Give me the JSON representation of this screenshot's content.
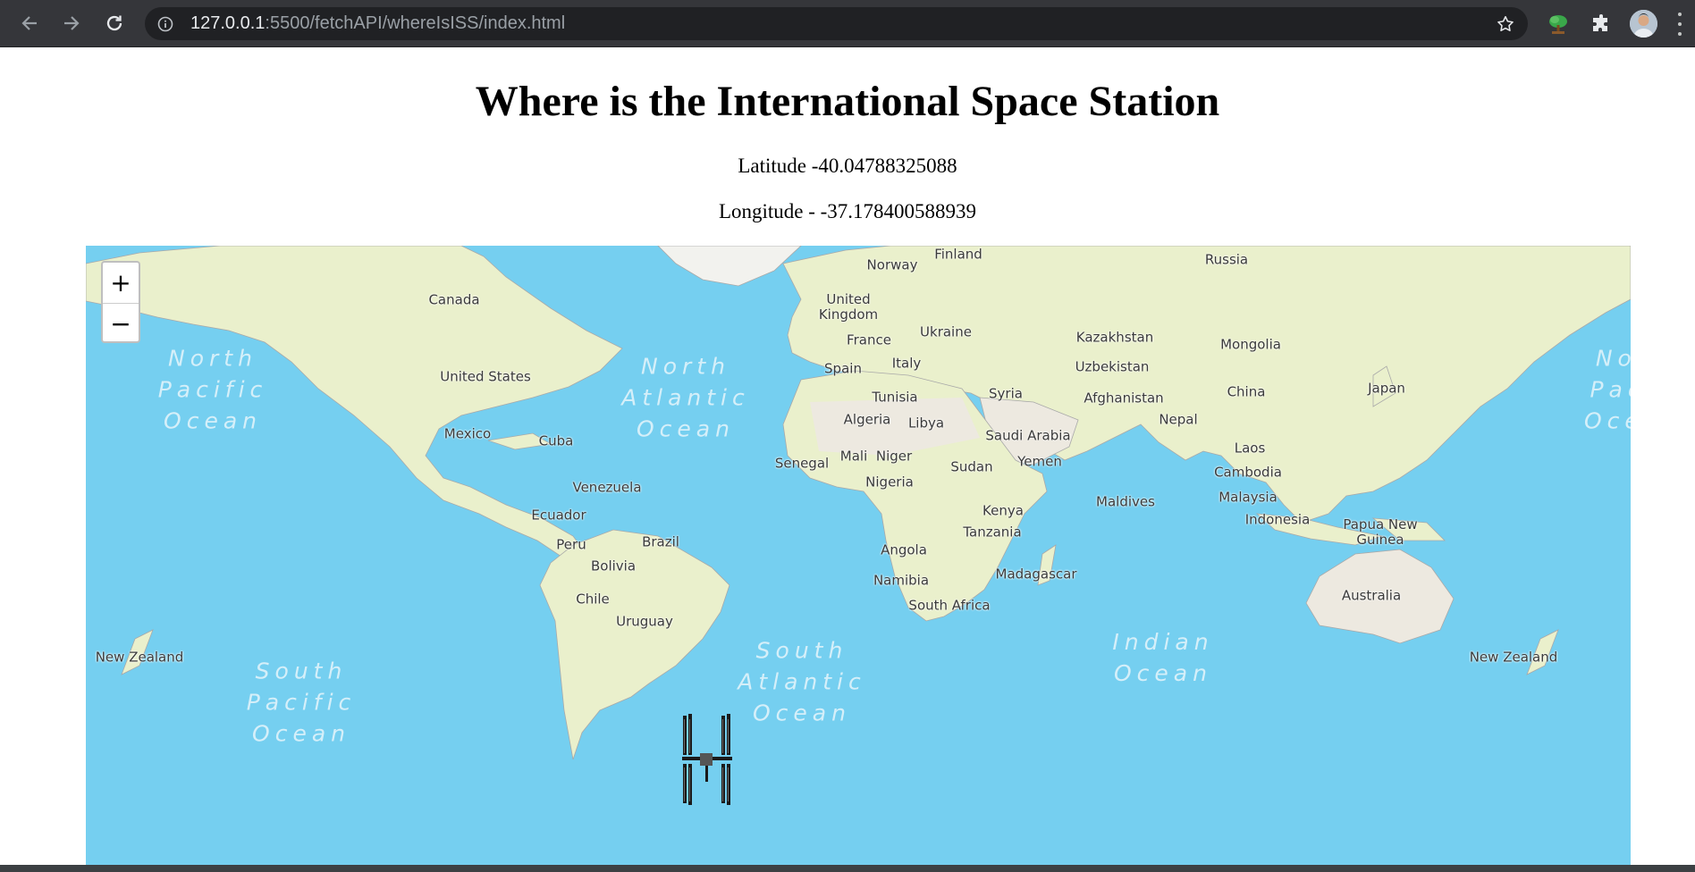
{
  "browser": {
    "url_host": "127.0.0.1",
    "url_rest": ":5500/fetchAPI/whereIsISS/index.html",
    "icons": [
      "back-arrow-icon",
      "forward-arrow-icon",
      "reload-icon",
      "info-icon",
      "star-icon",
      "tree-extension-icon",
      "puzzle-extensions-icon",
      "profile-avatar",
      "more-menu-icon"
    ]
  },
  "page": {
    "title": "Where is the International Space Station",
    "latitude_text": "Latitude -40.04788325088",
    "longitude_text": "Longitude - -37.178400588939"
  },
  "map": {
    "zoom_in": "+",
    "zoom_out": "−",
    "colors": {
      "ocean": "#75cff0",
      "land": "#eaf0cc",
      "desert": "#ede9e0",
      "border": "#a9a9a9"
    },
    "oceans": {
      "north_pacific_w": "North\nPacific\nOcean",
      "north_pacific_e": "Nor\nPaci\nOcea",
      "north_atlantic": "North\nAtlantic\nOcean",
      "south_pacific": "South\nPacific\nOcean",
      "south_atlantic": "South\nAtlantic\nOcean",
      "indian": "Indian\nOcean"
    },
    "labels": {
      "norway": "Norway",
      "finland": "Finland",
      "russia": "Russia",
      "canada": "Canada",
      "uk": "United\nKingdom",
      "ukraine": "Ukraine",
      "kazakhstan": "Kazakhstan",
      "mongolia": "Mongolia",
      "france": "France",
      "italy": "Italy",
      "spain": "Spain",
      "uzbekistan": "Uzbekistan",
      "united_states": "United States",
      "syria": "Syria",
      "afghanistan": "Afghanistan",
      "china": "China",
      "japan": "Japan",
      "tunisia": "Tunisia",
      "algeria": "Algeria",
      "libya": "Libya",
      "nepal": "Nepal",
      "saudi": "Saudi Arabia",
      "mexico": "Mexico",
      "cuba": "Cuba",
      "laos": "Laos",
      "yemen": "Yemen",
      "senegal": "Senegal",
      "mali": "Mali",
      "niger": "Niger",
      "sudan": "Sudan",
      "cambodia": "Cambodia",
      "nigeria": "Nigeria",
      "venezuela": "Venezuela",
      "malaysia": "Malaysia",
      "maldives": "Maldives",
      "kenya": "Kenya",
      "ecuador": "Ecuador",
      "indonesia": "Indonesia",
      "png": "Papua New\nGuinea",
      "tanzania": "Tanzania",
      "brazil": "Brazil",
      "peru": "Peru",
      "bolivia": "Bolivia",
      "angola": "Angola",
      "madagascar": "Madagascar",
      "namibia": "Namibia",
      "australia": "Australia",
      "chile": "Chile",
      "south_africa": "South Africa",
      "uruguay": "Uruguay",
      "nz_w": "New Zealand",
      "nz_e": "New Zealand"
    },
    "marker": "iss-marker"
  }
}
